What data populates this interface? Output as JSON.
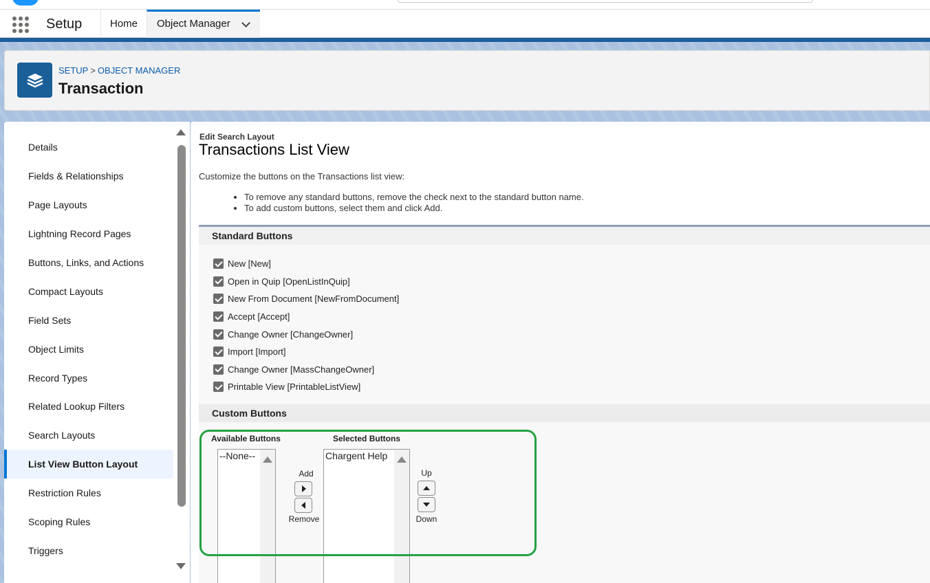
{
  "header": {
    "app_name": "Setup",
    "tabs": [
      {
        "label": "Home"
      },
      {
        "label": "Object Manager"
      }
    ]
  },
  "page_header": {
    "breadcrumb": [
      "SETUP",
      "OBJECT MANAGER"
    ],
    "breadcrumb_separator": ">",
    "title": "Transaction",
    "icon": "layers-icon"
  },
  "sidebar": {
    "items": [
      {
        "label": "Details"
      },
      {
        "label": "Fields & Relationships"
      },
      {
        "label": "Page Layouts"
      },
      {
        "label": "Lightning Record Pages"
      },
      {
        "label": "Buttons, Links, and Actions"
      },
      {
        "label": "Compact Layouts"
      },
      {
        "label": "Field Sets"
      },
      {
        "label": "Object Limits"
      },
      {
        "label": "Record Types"
      },
      {
        "label": "Related Lookup Filters"
      },
      {
        "label": "Search Layouts"
      },
      {
        "label": "List View Button Layout"
      },
      {
        "label": "Restriction Rules"
      },
      {
        "label": "Scoping Rules"
      },
      {
        "label": "Triggers"
      }
    ],
    "active_index": 11
  },
  "main": {
    "eyebrow": "Edit Search Layout",
    "title": "Transactions List View",
    "intro": "Customize the buttons on the Transactions list view:",
    "bullets": [
      "To remove any standard buttons, remove the check next to the standard button name.",
      "To add custom buttons, select them and click Add."
    ],
    "standard_buttons": {
      "heading": "Standard Buttons",
      "items": [
        {
          "label": "New [New]",
          "checked": true
        },
        {
          "label": "Open in Quip [OpenListInQuip]",
          "checked": true
        },
        {
          "label": "New From Document [NewFromDocument]",
          "checked": true
        },
        {
          "label": "Accept [Accept]",
          "checked": true
        },
        {
          "label": "Change Owner [ChangeOwner]",
          "checked": true
        },
        {
          "label": "Import [Import]",
          "checked": true
        },
        {
          "label": "Change Owner [MassChangeOwner]",
          "checked": true
        },
        {
          "label": "Printable View [PrintableListView]",
          "checked": true
        }
      ]
    },
    "custom_buttons": {
      "heading": "Custom Buttons",
      "available_label": "Available Buttons",
      "selected_label": "Selected Buttons",
      "available_options": [
        "--None--"
      ],
      "selected_options": [
        "Chargent Help"
      ],
      "add_label": "Add",
      "remove_label": "Remove",
      "up_label": "Up",
      "down_label": "Down"
    }
  },
  "colors": {
    "brand_blue": "#0176d3",
    "header_bar": "#1f5d9c",
    "highlight_green": "#25a244"
  }
}
